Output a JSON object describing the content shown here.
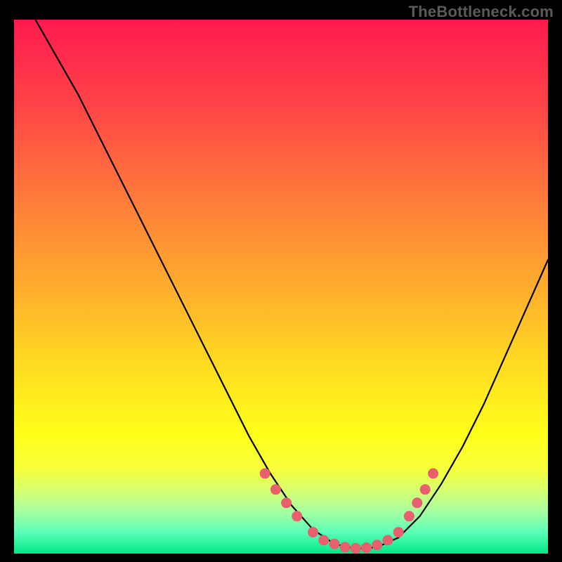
{
  "watermark": "TheBottleneck.com",
  "colors": {
    "dot": "#e85f6d",
    "curve": "#000000"
  },
  "chart_data": {
    "type": "line",
    "title": "",
    "xlabel": "",
    "ylabel": "",
    "xlim": [
      0,
      100
    ],
    "ylim": [
      0,
      100
    ],
    "grid": false,
    "legend": false,
    "series": [
      {
        "name": "curve",
        "x": [
          4,
          8,
          12,
          16,
          20,
          24,
          28,
          32,
          36,
          40,
          44,
          48,
          52,
          56,
          60,
          64,
          68,
          72,
          76,
          80,
          84,
          88,
          92,
          96,
          100
        ],
        "y": [
          100,
          93,
          86,
          78,
          70,
          62,
          54,
          46,
          38,
          30,
          22,
          15,
          9,
          4.5,
          1.8,
          0.9,
          1.2,
          3,
          7,
          13,
          20,
          28,
          37,
          46,
          55
        ]
      }
    ],
    "markers": {
      "name": "threshold-dots",
      "points": [
        {
          "x": 47,
          "y": 15.0
        },
        {
          "x": 49,
          "y": 12.0
        },
        {
          "x": 51,
          "y": 9.5
        },
        {
          "x": 53,
          "y": 7.0
        },
        {
          "x": 56,
          "y": 4.0
        },
        {
          "x": 58,
          "y": 2.5
        },
        {
          "x": 60,
          "y": 1.8
        },
        {
          "x": 62,
          "y": 1.2
        },
        {
          "x": 64,
          "y": 1.0
        },
        {
          "x": 66,
          "y": 1.1
        },
        {
          "x": 68,
          "y": 1.6
        },
        {
          "x": 70,
          "y": 2.5
        },
        {
          "x": 72,
          "y": 4.0
        },
        {
          "x": 74,
          "y": 7.0
        },
        {
          "x": 75.5,
          "y": 9.5
        },
        {
          "x": 77,
          "y": 12.0
        },
        {
          "x": 78.5,
          "y": 15.0
        }
      ]
    },
    "gradient_stops": [
      {
        "pos": 0,
        "color": "#ff1a4d"
      },
      {
        "pos": 28,
        "color": "#ff6a3e"
      },
      {
        "pos": 62,
        "color": "#ffd323"
      },
      {
        "pos": 84,
        "color": "#d8ff6e"
      },
      {
        "pos": 100,
        "color": "#00e888"
      }
    ]
  }
}
